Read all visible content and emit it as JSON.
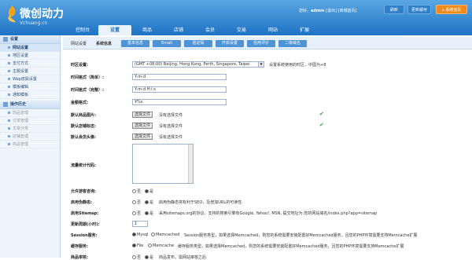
{
  "header": {
    "logo_text": "微创动力",
    "logo_sub": "Vchuang.cn",
    "greeting": "您好，",
    "username": "admin",
    "logout": "[退出]",
    "store_link": "[商城首页]",
    "refresh": "刷新",
    "update_cache": "更新缓存",
    "home_label": "系统首页"
  },
  "nav": {
    "items": [
      {
        "label": "控制台"
      },
      {
        "label": "设置",
        "active": true
      },
      {
        "label": "商品"
      },
      {
        "label": "店铺"
      },
      {
        "label": "会员"
      },
      {
        "label": "交易"
      },
      {
        "label": "网站"
      },
      {
        "label": "扩展"
      }
    ]
  },
  "sidebar": {
    "sections": [
      {
        "title": "设置",
        "items": [
          {
            "label": "网站设置",
            "active": true
          },
          {
            "label": "地区设置"
          },
          {
            "label": "支付方式"
          },
          {
            "label": "主题设置"
          },
          {
            "label": "Wap皮肤设置"
          },
          {
            "label": "模板编辑"
          },
          {
            "label": "通知模板"
          }
        ]
      },
      {
        "title": "操作历史",
        "items": [
          {
            "label": "商品管理",
            "dim": true
          },
          {
            "label": "订单管理",
            "dim": true
          },
          {
            "label": "文章分类",
            "dim": true
          },
          {
            "label": "店铺管理",
            "dim": true
          },
          {
            "label": "商品管理",
            "dim": true
          }
        ]
      }
    ]
  },
  "subtabs": {
    "crumb1": "网站设置",
    "crumb2": "系统信息",
    "tabs": [
      "基本信息",
      "Email",
      "验证码",
      "开启设置",
      "信用评价",
      "二级域名"
    ]
  },
  "form": {
    "timezone": {
      "label": "时区设置:",
      "value": "(GMT +08:00) Beijing, Hong Kong, Perth, Singapore, Taipei",
      "hint": "设置系统使用的时区，中国为+8"
    },
    "time_short": {
      "label": "时间格式（简单）:",
      "value": "Y-m-d"
    },
    "time_full": {
      "label": "时间格式（完整）:",
      "value": "Y-m-d H:i:s"
    },
    "currency": {
      "label": "金额格式:",
      "value": "¥%s"
    },
    "default_goods_img": {
      "label": "默认商品图片:",
      "button": "选择文件",
      "status": "没有选择文件"
    },
    "default_store_logo": {
      "label": "默认店铺标志:",
      "button": "选择文件",
      "status": "没有选择文件"
    },
    "default_avatar": {
      "label": "默认会员头像:",
      "button": "选择文件",
      "status": "没有选择文件"
    },
    "stats_code": {
      "label": "流量统计代码:"
    },
    "guest_consult": {
      "label": "允许游客咨询:",
      "yes": "否",
      "no": "是"
    },
    "pseudo_static": {
      "label": "启用伪静态:",
      "yes": "否",
      "no": "是",
      "hint": "启用伪静态将有利于SEO，及增加URL的可读性"
    },
    "sitemap": {
      "label": "启用Sitemap:",
      "yes": "否",
      "no": "是",
      "hint": "采用sitemaps.org的协议，支持的搜索引擎有Google, Yahoo!, MSN, 提交地址为:您的网站域名/index.php?app=sitemap"
    },
    "update_cycle": {
      "label": "更新周期(小时):",
      "value": "1"
    },
    "session_store": {
      "label": "Session服务:",
      "opt1": "Mysql",
      "opt2": "Memcached",
      "hint": "Session服务类型，如果选择Memcached，则您的系统需要安装配置好Memcached服务，且您的PHP环境需要支持Memcache扩展"
    },
    "cache_store": {
      "label": "缓存服务:",
      "opt1": "File",
      "opt2": "Memcache",
      "hint": "缓存服务类型，如果选择Memcached，则您的系统需要安装配置好Memcached服务，且您的PHP环境需要支持Memcache扩展"
    },
    "goods_review": {
      "label": "商品审核:",
      "yes": "否",
      "no": "是",
      "hint": "商品发布，需网站审核之后"
    }
  }
}
